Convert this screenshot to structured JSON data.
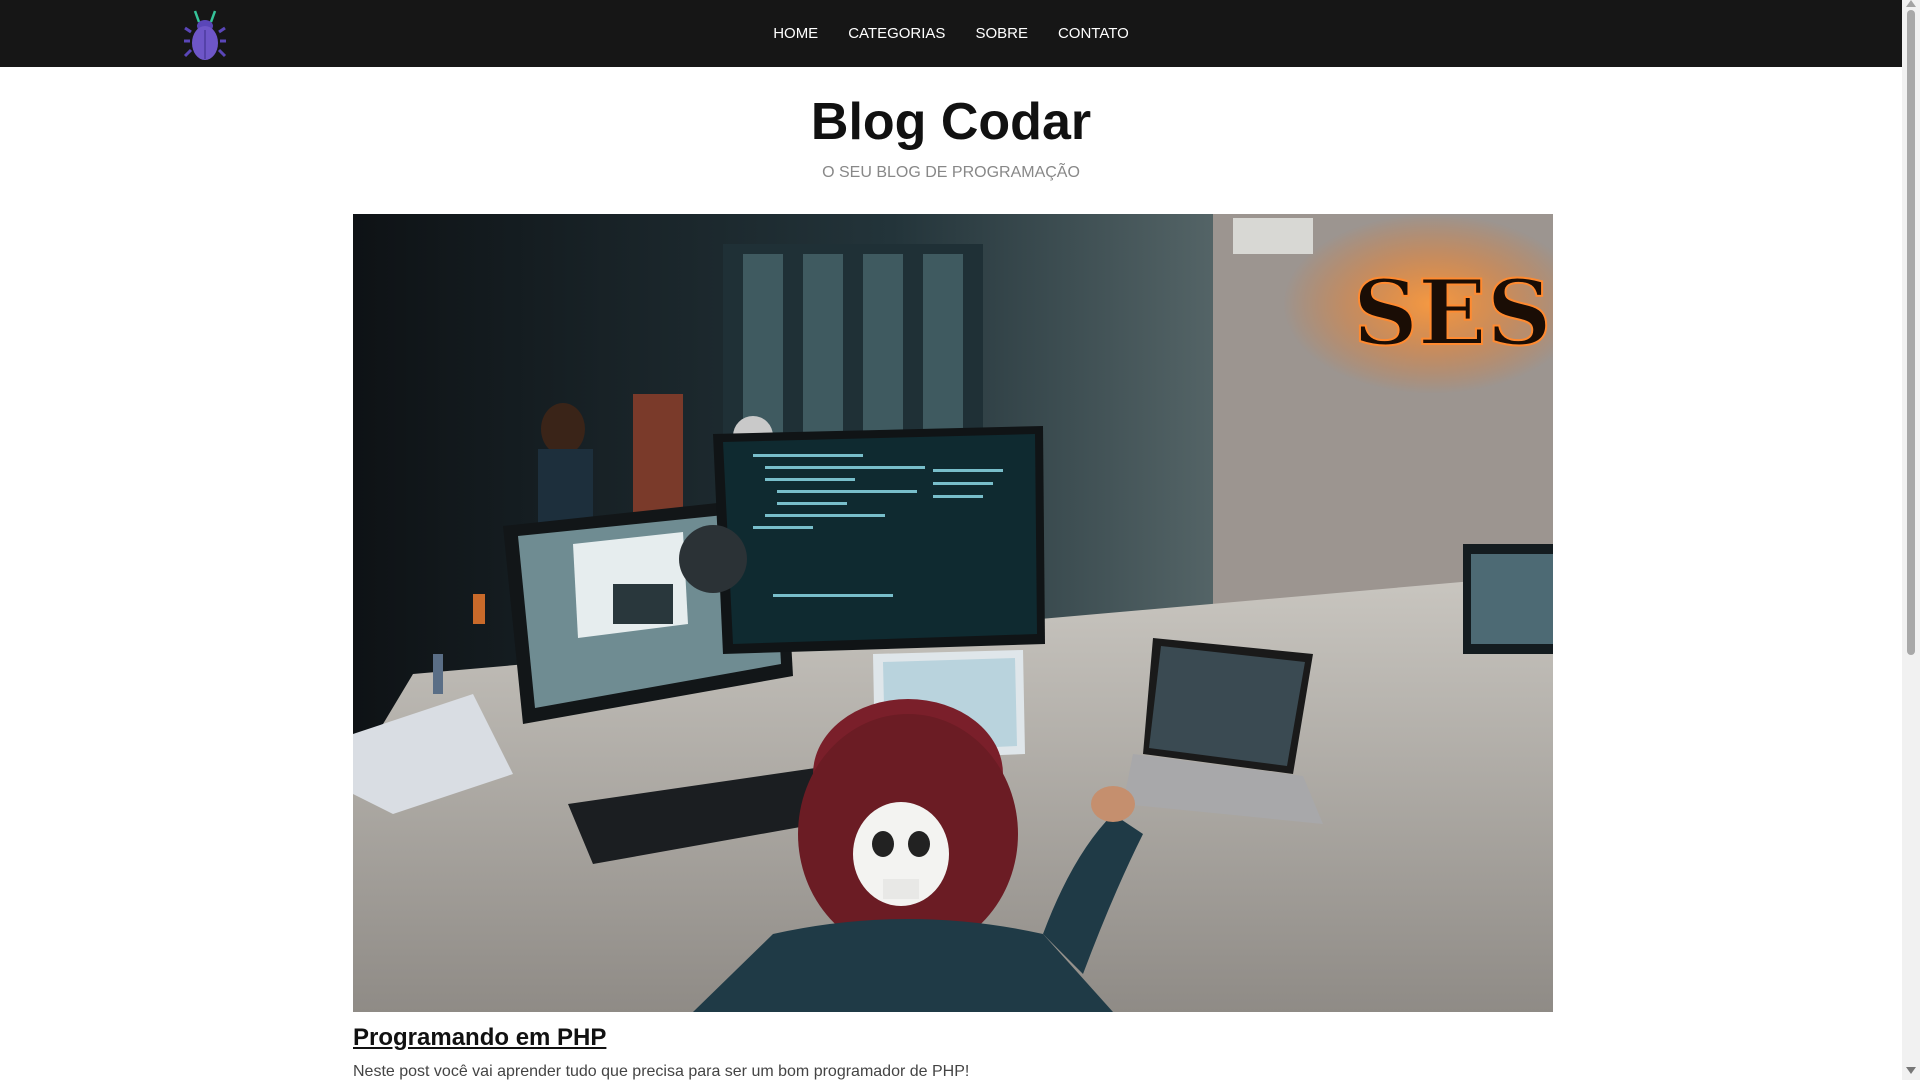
{
  "nav": {
    "logo_icon": "bug-icon",
    "links": [
      "HOME",
      "CATEGORIAS",
      "SOBRE",
      "CONTATO"
    ]
  },
  "header": {
    "title": "Blog Codar",
    "subtitle": "O SEU BLOG DE PROGRAMAÇÃO"
  },
  "post": {
    "image_icon": "programmer-desk-photo",
    "title": "Programando em PHP",
    "excerpt": "Neste post você vai aprender tudo que precisa para ser um bom programador de PHP!"
  },
  "colors": {
    "navbar": "#161616",
    "logo": "#6e56c8"
  }
}
